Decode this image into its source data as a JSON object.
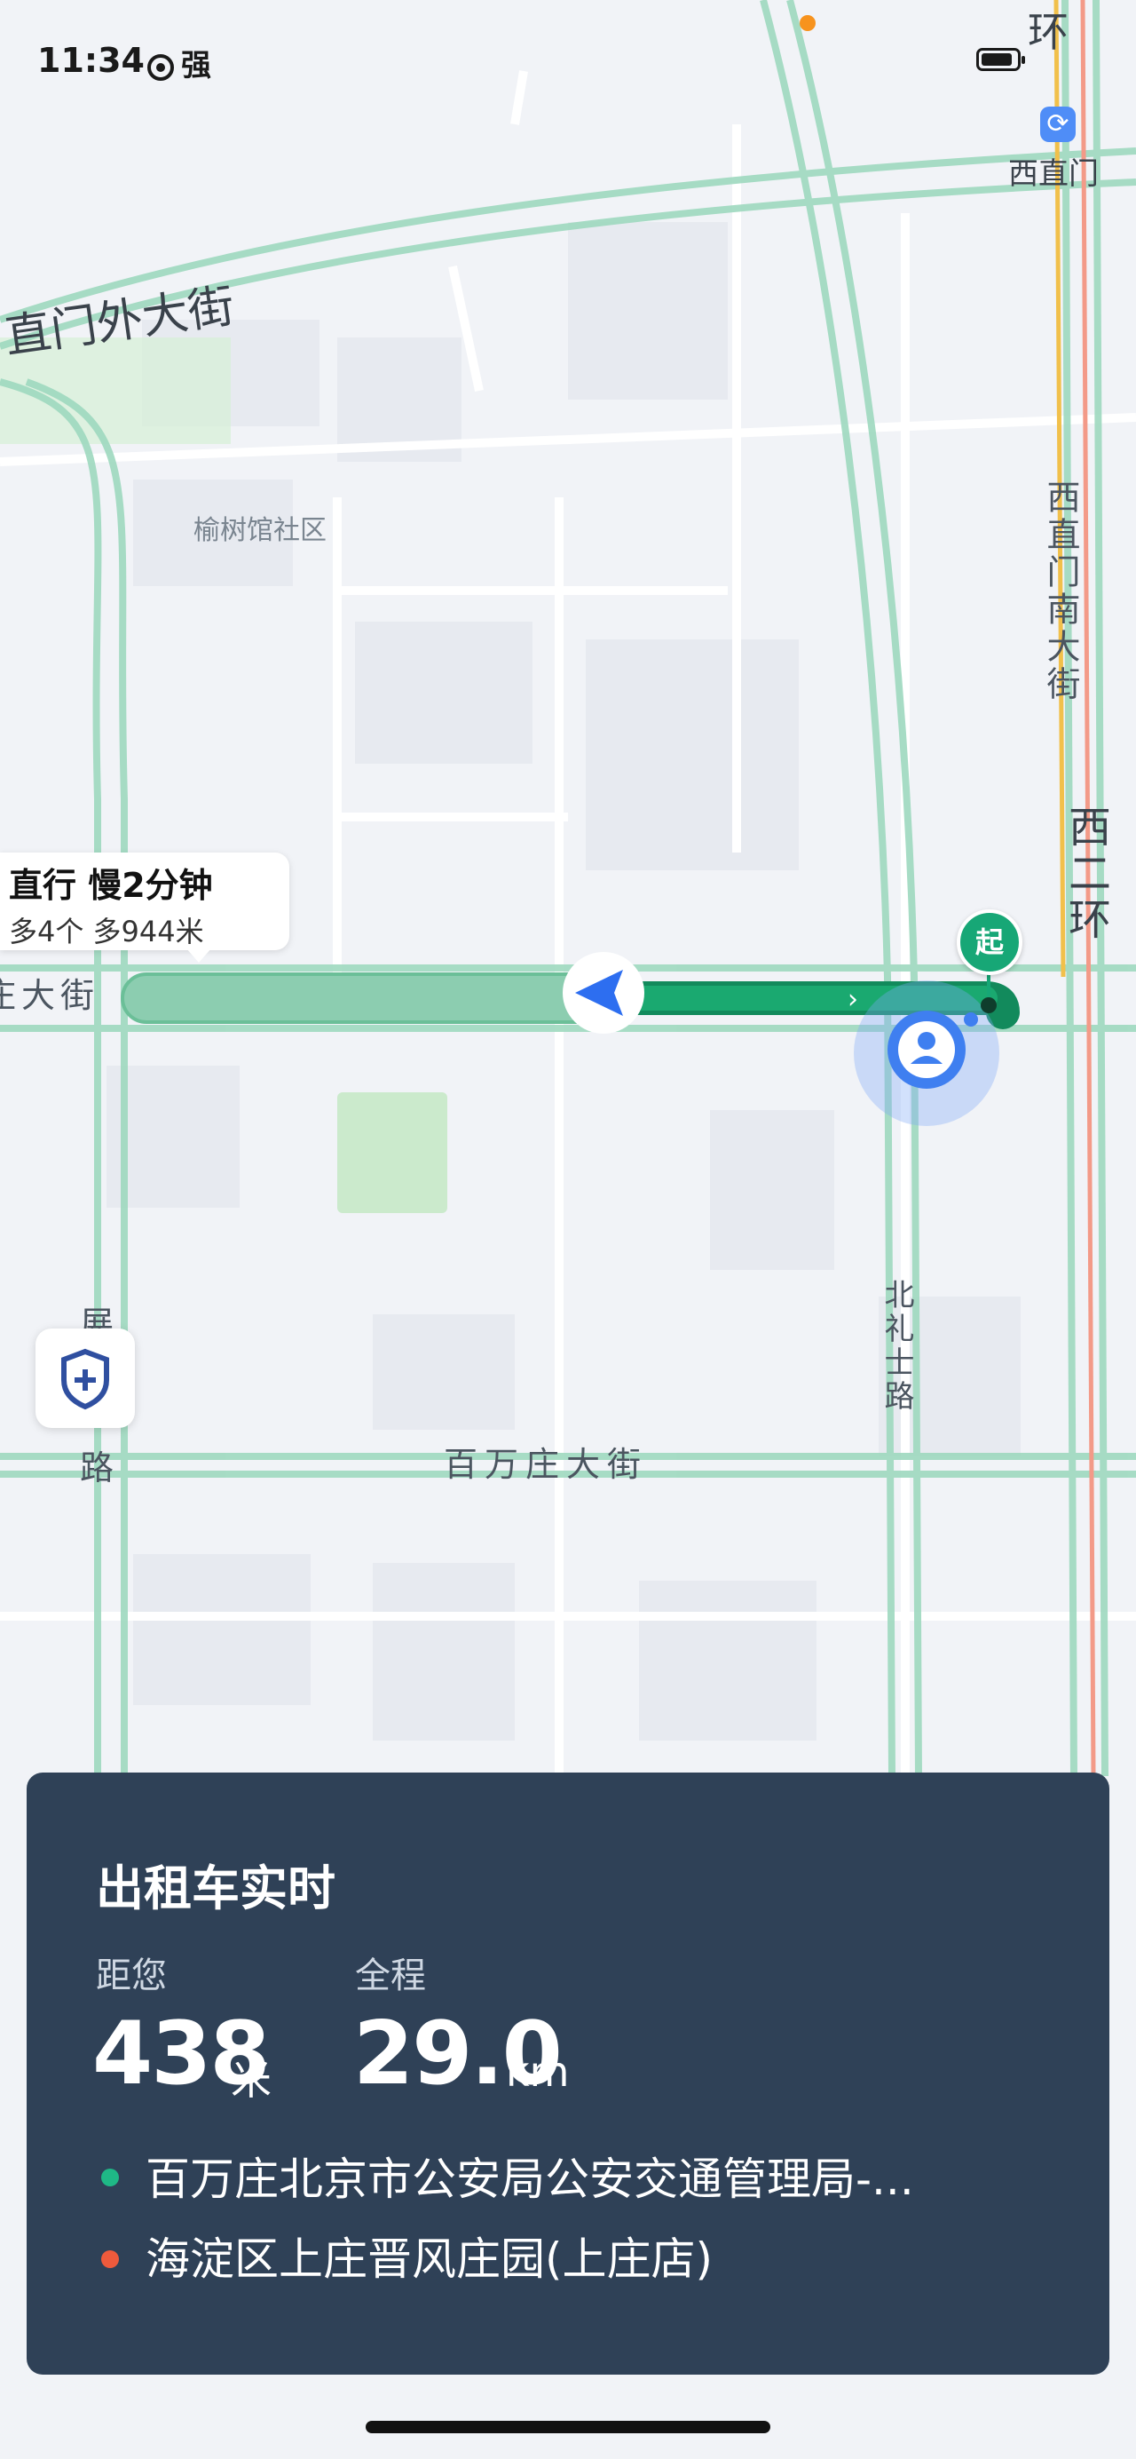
{
  "status_bar": {
    "time": "11:34",
    "signal_text": "强"
  },
  "map": {
    "labels": {
      "xizhimen_outer": "直门外大街",
      "yushuguan": "榆树馆社区",
      "xizhimen_metro": "西直门",
      "xizhimen_south": "西直门南大街",
      "west_second_ring": "西二环",
      "ring_top": "环",
      "left_street": "庄大街",
      "zhanlan_a": "展",
      "zhanlan_b": "路",
      "beilishi": "北礼士路",
      "baiwanzhuang": "百万庄大街"
    },
    "tip": {
      "title": "直行 慢2分钟",
      "subtitle": "多4个  多944米"
    },
    "start_marker": "起"
  },
  "info_panel": {
    "title": "出租车实时",
    "distance_label": "距您",
    "distance_value": "438",
    "distance_unit": "米",
    "total_label": "全程",
    "total_value": "29.0",
    "total_unit": "km",
    "origin": "百万庄北京市公安局公安交通管理局-...",
    "destination": "海淀区上庄晋风庄园(上庄店)"
  },
  "colors": {
    "route_active": "#1aa970",
    "route_alt": "#8ccdb0",
    "origin_dot": "#1fb886",
    "destination_dot": "#ee5a3c",
    "panel_bg": "#2f4157"
  }
}
